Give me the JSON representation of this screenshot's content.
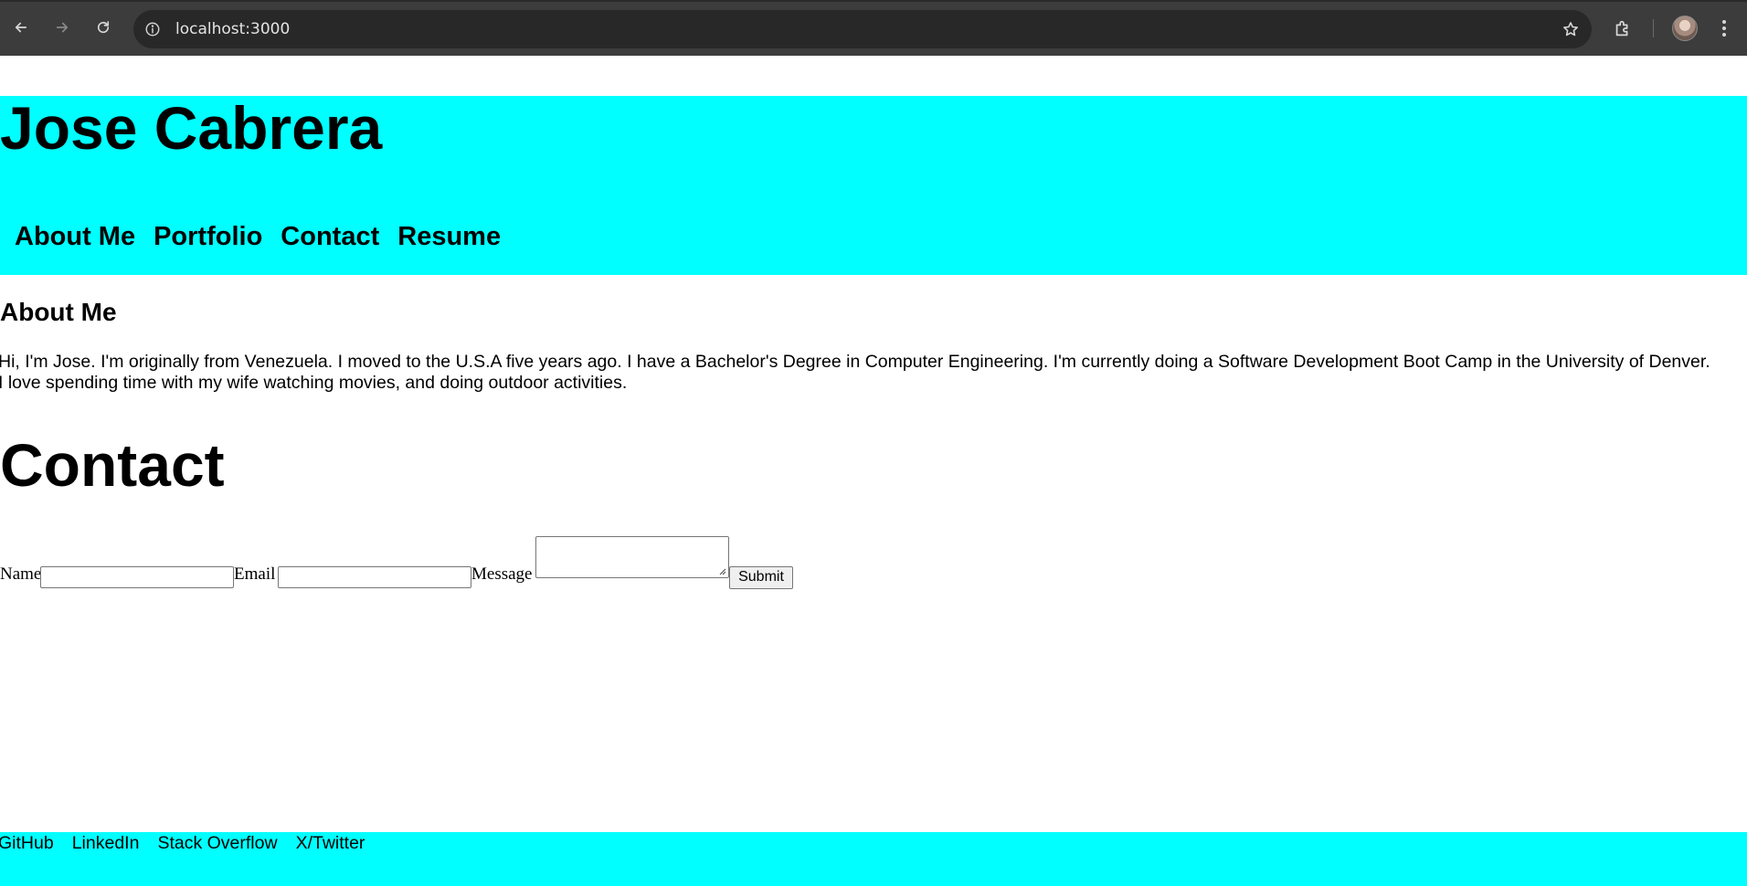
{
  "browser": {
    "url": "localhost:3000",
    "icons": {
      "back": "arrow-left-icon",
      "forward": "arrow-right-icon",
      "reload": "reload-icon",
      "site_info": "info-icon",
      "bookmark": "star-icon",
      "extensions": "puzzle-icon",
      "menu": "kebab-menu-icon"
    }
  },
  "header": {
    "name": "Jose Cabrera",
    "background": "#00ffff",
    "nav": [
      "About Me",
      "Portfolio",
      "Contact",
      "Resume"
    ]
  },
  "about": {
    "heading": "About Me",
    "text": "Hi, I'm Jose. I'm originally from Venezuela. I moved to the U.S.A five years ago. I have a Bachelor's Degree in Computer Engineering. I'm currently doing a Software Development Boot Camp in the University of Denver. I love spending time with my wife watching movies, and doing outdoor activities."
  },
  "contact": {
    "heading": "Contact",
    "form": {
      "name_label": "Name",
      "name_value": "",
      "email_label": "Email",
      "email_value": "",
      "message_label": "Message",
      "message_value": "",
      "submit_label": "Submit"
    }
  },
  "footer": {
    "background": "#00ffff",
    "links": [
      "GitHub",
      "LinkedIn",
      "Stack Overflow",
      "X/Twitter"
    ]
  }
}
